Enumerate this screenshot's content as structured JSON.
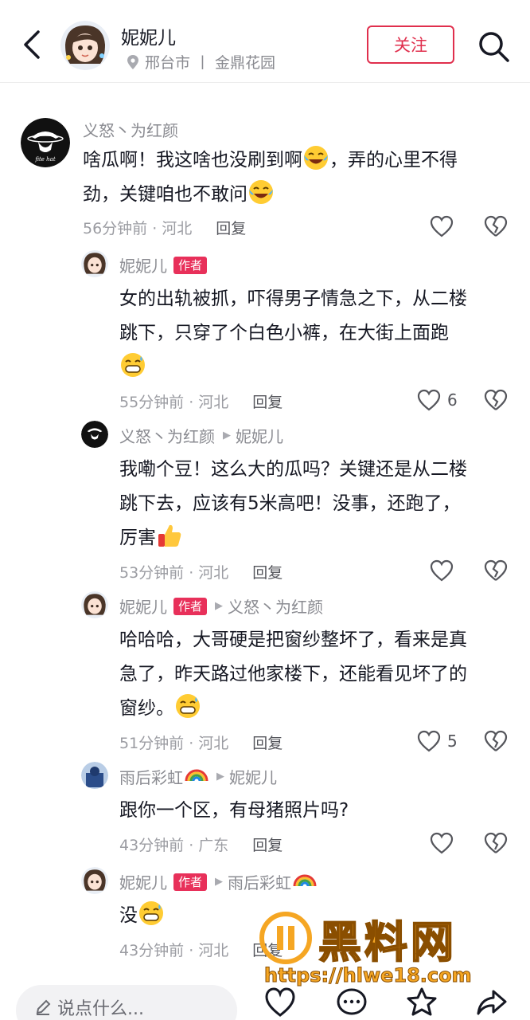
{
  "header": {
    "name": "妮妮儿",
    "city": "邢台市",
    "separator": "丨",
    "place": "金鼎花园",
    "follow_label": "关注"
  },
  "comments": [
    {
      "author": "义怒丶为红颜",
      "text": "啥瓜啊！我这啥也没刷到啊",
      "text2": "，弄的心里不得\n劲，关键咱也不敢问",
      "time": "56分钟前 · 河北",
      "reply": "回复",
      "likes": ""
    },
    {
      "author": "妮妮儿",
      "tag": "作者",
      "text": "女的出轨被抓，吓得男子情急之下，从二楼\n跳下，只穿了个白色小裤，在大街上面跑",
      "time": "55分钟前 · 河北",
      "reply": "回复",
      "likes": "6"
    },
    {
      "author": "义怒丶为红颜",
      "reply_to": "妮妮儿",
      "text": "我嘞个豆！这么大的瓜吗？关键还是从二楼\n跳下去，应该有5米高吧！没事，还跑了，\n厉害",
      "time": "53分钟前 · 河北",
      "reply": "回复",
      "likes": ""
    },
    {
      "author": "妮妮儿",
      "tag": "作者",
      "reply_to": "义怒丶为红颜",
      "text": "哈哈哈，大哥硬是把窗纱整坏了，看来是真\n急了，昨天路过他家楼下，还能看见坏了的\n窗纱。",
      "time": "51分钟前 · 河北",
      "reply": "回复",
      "likes": "5"
    },
    {
      "author": "雨后彩虹",
      "reply_to": "妮妮儿",
      "text": "跟你一个区，有母猪照片吗?",
      "time": "43分钟前 · 广东",
      "reply": "回复",
      "likes": ""
    },
    {
      "author": "妮妮儿",
      "tag": "作者",
      "reply_to": "雨后彩虹",
      "text": "没",
      "time": "43分钟前 · 河北",
      "reply": "回复",
      "likes": ""
    }
  ],
  "avatar_caption": "fite hat",
  "watermark": {
    "title": "黑料网",
    "url": "https://hlwe18.com"
  },
  "bottom": {
    "placeholder": "说点什么..."
  },
  "colors": {
    "accent": "#e02f4d",
    "author_tag": "#e8305a",
    "watermark": "#f5a623"
  },
  "icons": [
    "back-arrow-icon",
    "location-pin-icon",
    "search-icon",
    "heart-icon",
    "broken-heart-icon",
    "pencil-icon",
    "comment-icon",
    "star-icon",
    "share-icon"
  ]
}
